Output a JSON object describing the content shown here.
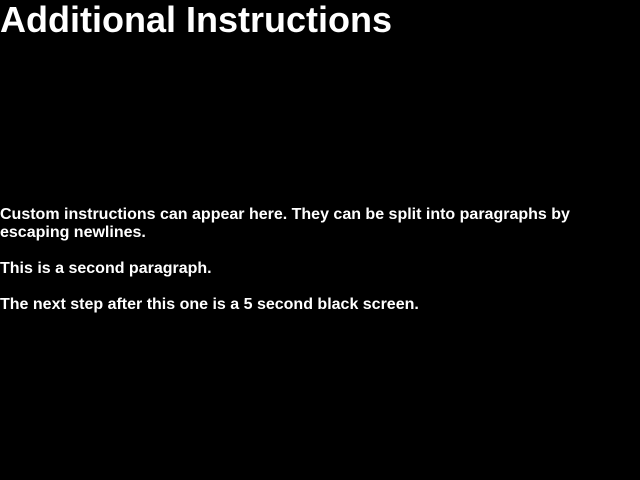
{
  "screen": {
    "title": "Additional Instructions",
    "paragraphs": [
      "Custom instructions can appear here. They can be split into paragraphs by escaping newlines.",
      "This is a second paragraph.",
      "The next step after this one is a 5 second black screen."
    ]
  },
  "colors": {
    "background": "#000000",
    "text": "#ffffff"
  }
}
